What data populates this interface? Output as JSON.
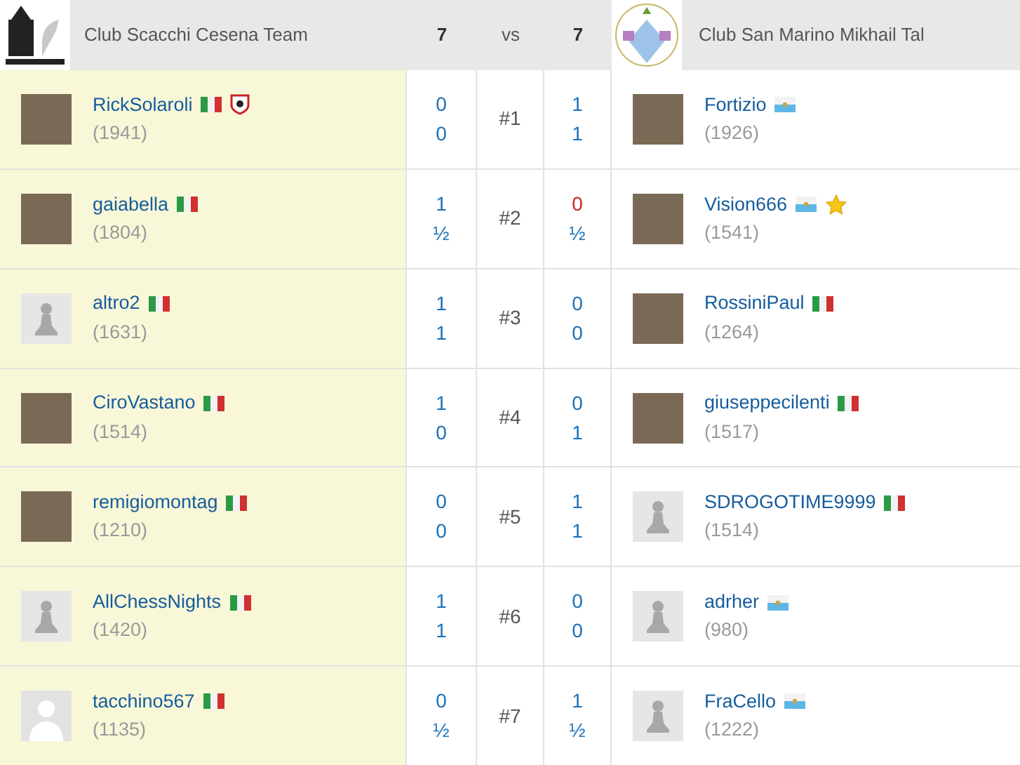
{
  "header": {
    "home_team": "Club Scacchi Cesena Team",
    "home_score": "7",
    "vs": "vs",
    "away_score": "7",
    "away_team": "Club San Marino Mikhail Tal"
  },
  "boards": [
    {
      "board": "#1",
      "home": {
        "name": "RickSolaroli",
        "rating": "(1941)",
        "avatar": {
          "kind": "photo"
        },
        "flag": {
          "kind": "italy"
        },
        "badge": {
          "kind": "shield"
        }
      },
      "home_scores": [
        {
          "text": "0",
          "highlight": false
        },
        {
          "text": "0",
          "highlight": false
        }
      ],
      "away_scores": [
        {
          "text": "1",
          "highlight": false
        },
        {
          "text": "1",
          "highlight": false
        }
      ],
      "away": {
        "name": "Fortizio",
        "rating": "(1926)",
        "avatar": {
          "kind": "photo"
        },
        "flag": {
          "kind": "sanmarino"
        }
      }
    },
    {
      "board": "#2",
      "home": {
        "name": "gaiabella",
        "rating": "(1804)",
        "avatar": {
          "kind": "photo"
        },
        "flag": {
          "kind": "italy"
        }
      },
      "home_scores": [
        {
          "text": "1",
          "highlight": false
        },
        {
          "text": "½",
          "highlight": false
        }
      ],
      "away_scores": [
        {
          "text": "0",
          "highlight": true
        },
        {
          "text": "½",
          "highlight": false
        }
      ],
      "away": {
        "name": "Vision666",
        "rating": "(1541)",
        "avatar": {
          "kind": "photo"
        },
        "flag": {
          "kind": "sanmarino"
        },
        "badge": {
          "kind": "star"
        }
      }
    },
    {
      "board": "#3",
      "home": {
        "name": "altro2",
        "rating": "(1631)",
        "avatar": {
          "kind": "pawn"
        },
        "flag": {
          "kind": "italy"
        }
      },
      "home_scores": [
        {
          "text": "1",
          "highlight": false
        },
        {
          "text": "1",
          "highlight": false
        }
      ],
      "away_scores": [
        {
          "text": "0",
          "highlight": false
        },
        {
          "text": "0",
          "highlight": false
        }
      ],
      "away": {
        "name": "RossiniPaul",
        "rating": "(1264)",
        "avatar": {
          "kind": "photo"
        },
        "flag": {
          "kind": "italy"
        }
      }
    },
    {
      "board": "#4",
      "home": {
        "name": "CiroVastano",
        "rating": "(1514)",
        "avatar": {
          "kind": "photo"
        },
        "flag": {
          "kind": "italy"
        }
      },
      "home_scores": [
        {
          "text": "1",
          "highlight": false
        },
        {
          "text": "0",
          "highlight": false
        }
      ],
      "away_scores": [
        {
          "text": "0",
          "highlight": false
        },
        {
          "text": "1",
          "highlight": false
        }
      ],
      "away": {
        "name": "giuseppecilenti",
        "rating": "(1517)",
        "avatar": {
          "kind": "photo"
        },
        "flag": {
          "kind": "italy"
        }
      }
    },
    {
      "board": "#5",
      "home": {
        "name": "remigiomontag",
        "rating": "(1210)",
        "avatar": {
          "kind": "photo"
        },
        "flag": {
          "kind": "italy"
        }
      },
      "home_scores": [
        {
          "text": "0",
          "highlight": false
        },
        {
          "text": "0",
          "highlight": false
        }
      ],
      "away_scores": [
        {
          "text": "1",
          "highlight": false
        },
        {
          "text": "1",
          "highlight": false
        }
      ],
      "away": {
        "name": "SDROGOTIME9999",
        "rating": "(1514)",
        "avatar": {
          "kind": "pawn"
        },
        "flag": {
          "kind": "italy"
        }
      }
    },
    {
      "board": "#6",
      "home": {
        "name": "AllChessNights",
        "rating": "(1420)",
        "avatar": {
          "kind": "pawn"
        },
        "flag": {
          "kind": "italy"
        }
      },
      "home_scores": [
        {
          "text": "1",
          "highlight": false
        },
        {
          "text": "1",
          "highlight": false
        }
      ],
      "away_scores": [
        {
          "text": "0",
          "highlight": false
        },
        {
          "text": "0",
          "highlight": false
        }
      ],
      "away": {
        "name": "adrher",
        "rating": "(980)",
        "avatar": {
          "kind": "pawn"
        },
        "flag": {
          "kind": "sanmarino"
        }
      }
    },
    {
      "board": "#7",
      "home": {
        "name": "tacchino567",
        "rating": "(1135)",
        "avatar": {
          "kind": "silhouette"
        },
        "flag": {
          "kind": "italy"
        }
      },
      "home_scores": [
        {
          "text": "0",
          "highlight": false
        },
        {
          "text": "½",
          "highlight": false
        }
      ],
      "away_scores": [
        {
          "text": "1",
          "highlight": false
        },
        {
          "text": "½",
          "highlight": false
        }
      ],
      "away": {
        "name": "FraCello",
        "rating": "(1222)",
        "avatar": {
          "kind": "pawn"
        },
        "flag": {
          "kind": "sanmarino"
        }
      }
    }
  ]
}
